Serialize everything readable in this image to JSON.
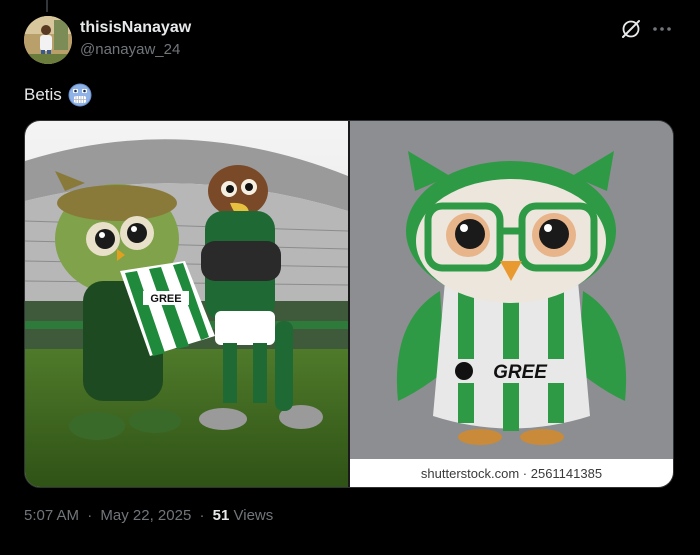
{
  "author": {
    "display_name": "thisisNanayaw",
    "handle": "@nanayaw_24"
  },
  "post": {
    "text": "Betis",
    "emoji": "astonished-face-emoji"
  },
  "media": {
    "right_watermark": "shutterstock.com · 2561141385",
    "left_jersey_brand": "GREE",
    "right_jersey_brand": "GREE"
  },
  "meta": {
    "time": "5:07 AM",
    "separator": "·",
    "date": "May 22, 2025",
    "views_count": "51",
    "views_label": "Views"
  },
  "icons": {
    "grok": "grok-icon",
    "more": "more-icon"
  },
  "colors": {
    "background": "#000000",
    "primary_text": "#e7e9ea",
    "secondary_text": "#71767b",
    "betis_green": "#1e8a3a"
  }
}
